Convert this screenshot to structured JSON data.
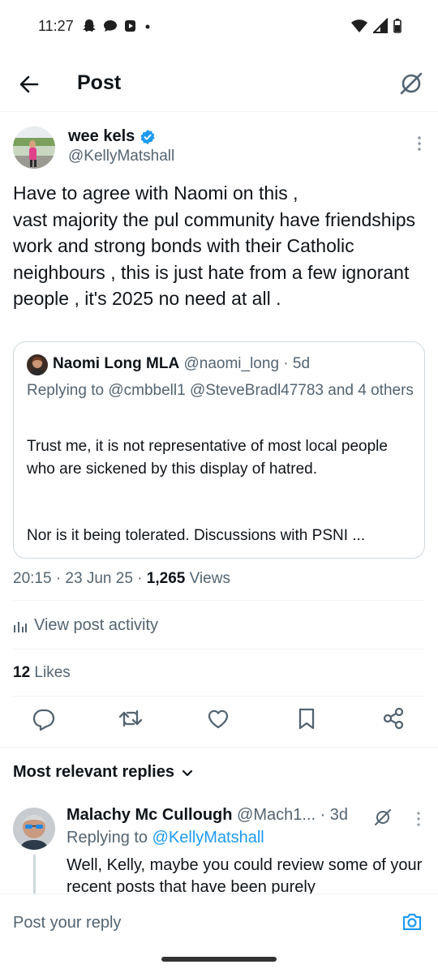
{
  "status_bar": {
    "time": "11:27",
    "left_icons": [
      "snapchat-icon",
      "chat-icon",
      "media-icon",
      "dot-icon"
    ],
    "right_icons": [
      "wifi-icon",
      "signal-icon",
      "battery-icon"
    ]
  },
  "top_bar": {
    "title": "Post"
  },
  "post": {
    "author_name": "wee kels",
    "author_handle": "@KellyMatshall",
    "text": "Have to agree with Naomi on this ,\nvast majority the pul community have friendships work and strong bonds with their Catholic neighbours , this is just hate from a few ignorant people , it's 2025 no need at all .",
    "quote": {
      "name": "Naomi Long MLA",
      "handle_time": "@naomi_long · 5d",
      "replying": "Replying to @cmbbell1 @SteveBradl47783 and 4 others",
      "text": "Trust me, it is not representative of most local people who are sickened by this display of hatred.",
      "text2": "Nor is it being tolerated. Discussions with PSNI ..."
    },
    "timestamp": "20:15 · 23 Jun 25 · ",
    "views_count": "1,265",
    "views_label": " Views",
    "activity_label": "View post activity",
    "likes_count": "12",
    "likes_label": " Likes"
  },
  "actions": [
    "reply-icon",
    "repost-icon",
    "like-icon",
    "bookmark-icon",
    "share-icon"
  ],
  "replies_header": "Most relevant replies",
  "reply": {
    "name": "Malachy Mc Cullough",
    "handle_time": " @Mach1... · 3d",
    "replying_prefix": "Replying to ",
    "replying_handle": "@KellyMatshall",
    "text": "Well, Kelly, maybe you could review some of your recent posts that have been purely"
  },
  "composer": {
    "placeholder": "Post your reply"
  },
  "colors": {
    "accent": "#1d9bf0",
    "secondary_text": "#536471",
    "primary_text": "#0f1419",
    "border": "#cfd9de"
  }
}
